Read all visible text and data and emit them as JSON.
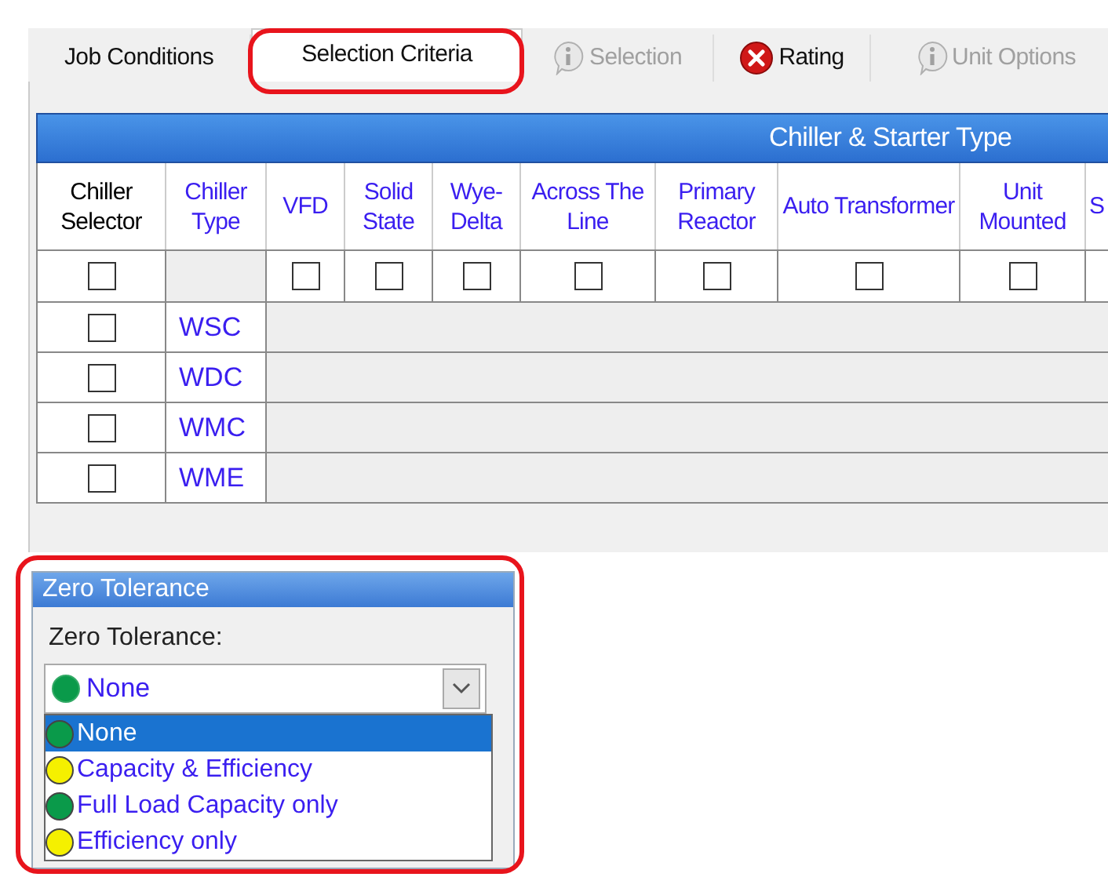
{
  "tabs": [
    {
      "label": "Job Conditions",
      "kind": "plain",
      "disabled": false,
      "selected": false
    },
    {
      "label": "Selection Criteria",
      "kind": "plain",
      "disabled": false,
      "selected": true
    },
    {
      "label": "Selection",
      "kind": "info",
      "disabled": true,
      "selected": false
    },
    {
      "label": "Rating",
      "kind": "error",
      "disabled": false,
      "selected": false
    },
    {
      "label": "Unit Options",
      "kind": "info",
      "disabled": true,
      "selected": false
    }
  ],
  "table": {
    "group_header": "Chiller & Starter Type",
    "columns": [
      {
        "label": "Chiller Selector",
        "kind": "select"
      },
      {
        "label": "Chiller Type",
        "kind": "type"
      },
      {
        "label": "VFD",
        "kind": "option"
      },
      {
        "label": "Solid State",
        "kind": "option"
      },
      {
        "label": "Wye- Delta",
        "kind": "option"
      },
      {
        "label": "Across The Line",
        "kind": "option"
      },
      {
        "label": "Primary Reactor",
        "kind": "option"
      },
      {
        "label": "Auto Transformer",
        "kind": "option"
      },
      {
        "label": "Unit Mounted",
        "kind": "option"
      },
      {
        "label": "S",
        "kind": "option"
      }
    ],
    "filter_row": [
      {
        "kind": "checkbox",
        "checked": false
      },
      {
        "kind": "blank"
      },
      {
        "kind": "checkbox",
        "checked": false
      },
      {
        "kind": "checkbox",
        "checked": false
      },
      {
        "kind": "checkbox",
        "checked": false
      },
      {
        "kind": "checkbox",
        "checked": false
      },
      {
        "kind": "checkbox",
        "checked": false
      },
      {
        "kind": "checkbox",
        "checked": false
      },
      {
        "kind": "checkbox",
        "checked": false
      },
      {
        "kind": "empty"
      }
    ],
    "rows": [
      {
        "checked": false,
        "type": "WSC"
      },
      {
        "checked": false,
        "type": "WDC"
      },
      {
        "checked": false,
        "type": "WMC"
      },
      {
        "checked": false,
        "type": "WME"
      }
    ]
  },
  "zero_tolerance": {
    "title": "Zero Tolerance",
    "label": "Zero Tolerance:",
    "value": {
      "text": "None",
      "color": "#0a9a4a"
    },
    "options": [
      {
        "label": "None",
        "color": "#0a9a4a",
        "selected": true
      },
      {
        "label": "Capacity & Efficiency",
        "color": "#f5f000",
        "selected": false
      },
      {
        "label": "Full Load Capacity only",
        "color": "#0a9a4a",
        "selected": false
      },
      {
        "label": "Efficiency only",
        "color": "#f5f000",
        "selected": false
      }
    ]
  }
}
